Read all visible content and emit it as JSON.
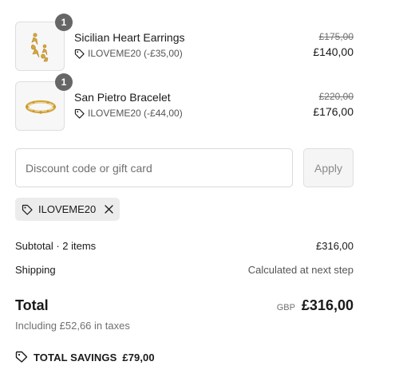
{
  "line_items": [
    {
      "name": "Sicilian Heart Earrings",
      "quantity": "1",
      "discount_label": "ILOVEME20 (-£35,00)",
      "original_price": "£175,00",
      "price": "£140,00",
      "image_icon": "earrings-image"
    },
    {
      "name": "San Pietro Bracelet",
      "quantity": "1",
      "discount_label": "ILOVEME20 (-£44,00)",
      "original_price": "£220,00",
      "price": "£176,00",
      "image_icon": "bracelet-image"
    }
  ],
  "discount": {
    "placeholder": "Discount code or gift card",
    "value": "",
    "apply_label": "Apply",
    "applied_code": "ILOVEME20"
  },
  "summary": {
    "subtotal_label": "Subtotal · 2 items",
    "subtotal_value": "£316,00",
    "shipping_label": "Shipping",
    "shipping_value": "Calculated at next step",
    "total_label": "Total",
    "currency": "GBP",
    "total_value": "£316,00",
    "taxes_note": "Including £52,66 in taxes",
    "savings_label": "TOTAL SAVINGS",
    "savings_value": "£79,00"
  },
  "icons": {
    "tag": "tag-icon",
    "close": "close-icon",
    "savings": "savings-tag-icon"
  },
  "colors": {
    "badge": "#666666",
    "code_tag_bg": "#ececec",
    "gold": "#d4a63c"
  }
}
